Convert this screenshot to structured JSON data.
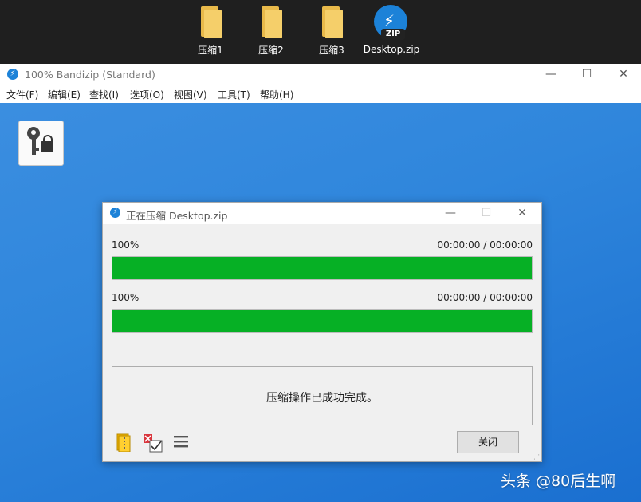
{
  "desktop": {
    "icons": [
      {
        "label": "压缩1",
        "type": "folder"
      },
      {
        "label": "压缩2",
        "type": "folder"
      },
      {
        "label": "压缩3",
        "type": "folder"
      },
      {
        "label": "Desktop.zip",
        "type": "zip",
        "badge": "ZIP"
      }
    ]
  },
  "window": {
    "title": "100% Bandizip (Standard)",
    "controls": {
      "minimize": "—",
      "maximize": "☐",
      "close": "✕"
    },
    "menu": [
      "文件(F)",
      "编辑(E)",
      "查找(I)",
      "选项(O)",
      "视图(V)",
      "工具(T)",
      "帮助(H)"
    ],
    "toolbar_icon": "key-lock-icon"
  },
  "dialog": {
    "title": "正在压缩 Desktop.zip",
    "controls": {
      "minimize": "—",
      "maximize": "☐",
      "close": "✕"
    },
    "progress1": {
      "percent_label": "100%",
      "time": "00:00:00 / 00:00:00",
      "value": 1.0
    },
    "progress2": {
      "percent_label": "100%",
      "time": "00:00:00 / 00:00:00",
      "value": 1.0
    },
    "message": "压缩操作已成功完成。",
    "close_button": "关闭",
    "bottom_icons": [
      "open-folder-icon",
      "verify-check-icon",
      "menu-icon"
    ]
  },
  "watermark": "头条 @80后生啊",
  "colors": {
    "progress_fill": "#06b025",
    "accent": "#1c82d8",
    "workspace": "#2f86dc"
  }
}
